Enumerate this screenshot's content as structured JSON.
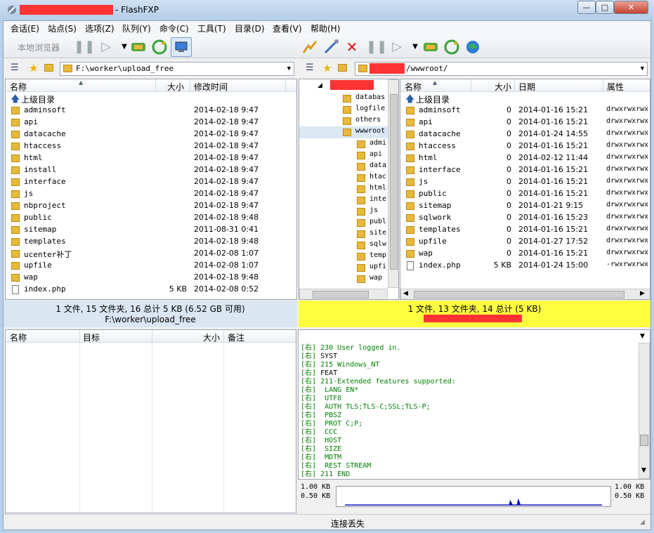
{
  "window": {
    "title": "- FlashFXP"
  },
  "menu": [
    "会话(E)",
    "站点(S)",
    "选项(Z)",
    "队列(Y)",
    "命令(C)",
    "工具(T)",
    "目录(D)",
    "查看(V)",
    "帮助(H)"
  ],
  "left_toolbar": {
    "local_label": "本地浏览器"
  },
  "left_path": "F:\\worker\\upload_free",
  "right_path": "/wwwroot/",
  "left_headers": {
    "name": "名称",
    "size": "大小",
    "modified": "修改时间"
  },
  "right_headers": {
    "name": "名称",
    "size": "大小",
    "date": "日期",
    "attr": "属性"
  },
  "parent_dir": "上级目录",
  "left_files": [
    {
      "name": "adminsoft",
      "size": "",
      "date": "2014-02-18 9:47"
    },
    {
      "name": "api",
      "size": "",
      "date": "2014-02-18 9:47"
    },
    {
      "name": "datacache",
      "size": "",
      "date": "2014-02-18 9:47"
    },
    {
      "name": "htaccess",
      "size": "",
      "date": "2014-02-18 9:47"
    },
    {
      "name": "html",
      "size": "",
      "date": "2014-02-18 9:47"
    },
    {
      "name": "install",
      "size": "",
      "date": "2014-02-18 9:47"
    },
    {
      "name": "interface",
      "size": "",
      "date": "2014-02-18 9:47"
    },
    {
      "name": "js",
      "size": "",
      "date": "2014-02-18 9:47"
    },
    {
      "name": "nbproject",
      "size": "",
      "date": "2014-02-18 9:47"
    },
    {
      "name": "public",
      "size": "",
      "date": "2014-02-18 9:48"
    },
    {
      "name": "sitemap",
      "size": "",
      "date": "2011-08-31 0:41"
    },
    {
      "name": "templates",
      "size": "",
      "date": "2014-02-18 9:48"
    },
    {
      "name": "ucenter补丁",
      "size": "",
      "date": "2014-02-08 1:07"
    },
    {
      "name": "upfile",
      "size": "",
      "date": "2014-02-08 1:07"
    },
    {
      "name": "wap",
      "size": "",
      "date": "2014-02-18 9:48"
    },
    {
      "name": "index.php",
      "size": "5 KB",
      "date": "2014-02-08 0:52",
      "file": true
    }
  ],
  "right_files": [
    {
      "name": "adminsoft",
      "size": "0",
      "date": "2014-01-16 15:21",
      "attr": "drwxrwxrwx"
    },
    {
      "name": "api",
      "size": "0",
      "date": "2014-01-16 15:21",
      "attr": "drwxrwxrwx"
    },
    {
      "name": "datacache",
      "size": "0",
      "date": "2014-01-24 14:55",
      "attr": "drwxrwxrwx"
    },
    {
      "name": "htaccess",
      "size": "0",
      "date": "2014-01-16 15:21",
      "attr": "drwxrwxrwx"
    },
    {
      "name": "html",
      "size": "0",
      "date": "2014-02-12 11:44",
      "attr": "drwxrwxrwx"
    },
    {
      "name": "interface",
      "size": "0",
      "date": "2014-01-16 15:21",
      "attr": "drwxrwxrwx"
    },
    {
      "name": "js",
      "size": "0",
      "date": "2014-01-16 15:21",
      "attr": "drwxrwxrwx"
    },
    {
      "name": "public",
      "size": "0",
      "date": "2014-01-16 15:21",
      "attr": "drwxrwxrwx"
    },
    {
      "name": "sitemap",
      "size": "0",
      "date": "2014-01-21 9:15",
      "attr": "drwxrwxrwx"
    },
    {
      "name": "sqlwork",
      "size": "0",
      "date": "2014-01-16 15:23",
      "attr": "drwxrwxrwx"
    },
    {
      "name": "templates",
      "size": "0",
      "date": "2014-01-16 15:21",
      "attr": "drwxrwxrwx"
    },
    {
      "name": "upfile",
      "size": "0",
      "date": "2014-01-27 17:52",
      "attr": "drwxrwxrwx"
    },
    {
      "name": "wap",
      "size": "0",
      "date": "2014-01-16 15:21",
      "attr": "drwxrwxrwx"
    },
    {
      "name": "index.php",
      "size": "5 KB",
      "date": "2014-01-24 15:00",
      "attr": "-rwxrwxrwx",
      "file": true
    }
  ],
  "tree_top": [
    "databas",
    "logfile",
    "others",
    "wwwroot"
  ],
  "tree_children": [
    "admi",
    "api",
    "data",
    "htac",
    "html",
    "inte",
    "js",
    "publ",
    "site",
    "sqlw",
    "temp",
    "upfi",
    "wap"
  ],
  "left_status": {
    "line1": "1 文件, 15 文件夹, 16 总计 5 KB (6.52 GB 可用)",
    "line2": "F:\\worker\\upload_free"
  },
  "right_status": {
    "line1": "1 文件, 13 文件夹, 14 总计 (5 KB)"
  },
  "queue_headers": {
    "name": "名称",
    "target": "目标",
    "size": "大小",
    "note": "备注"
  },
  "log_lines": [
    {
      "p": "[右]",
      "t": "230 User logged in.",
      "c": "#008000"
    },
    {
      "p": "[右]",
      "t": "SYST",
      "c": "#000000"
    },
    {
      "p": "[右]",
      "t": "215 Windows_NT",
      "c": "#008000"
    },
    {
      "p": "[右]",
      "t": "FEAT",
      "c": "#000000"
    },
    {
      "p": "[右]",
      "t": "211-Extended features supported:",
      "c": "#008000"
    },
    {
      "p": "[右]",
      "t": " LANG EN*",
      "c": "#008000"
    },
    {
      "p": "[右]",
      "t": " UTF8",
      "c": "#008000"
    },
    {
      "p": "[右]",
      "t": " AUTH TLS;TLS-C;SSL;TLS-P;",
      "c": "#008000"
    },
    {
      "p": "[右]",
      "t": " PBSZ",
      "c": "#008000"
    },
    {
      "p": "[右]",
      "t": " PROT C;P;",
      "c": "#008000"
    },
    {
      "p": "[右]",
      "t": " CCC",
      "c": "#008000"
    },
    {
      "p": "[右]",
      "t": " HOST",
      "c": "#008000"
    },
    {
      "p": "[右]",
      "t": " SIZE",
      "c": "#008000"
    },
    {
      "p": "[右]",
      "t": " MDTM",
      "c": "#008000"
    },
    {
      "p": "[右]",
      "t": " REST STREAM",
      "c": "#008000"
    },
    {
      "p": "[右]",
      "t": "211 END",
      "c": "#008000"
    }
  ],
  "graph": {
    "top_label": "1.00 KB",
    "mid_label": "0.50 KB"
  },
  "statusbar": "连接丢失",
  "colors": {
    "highlight": "#fffd40",
    "redaction": "#ff3333",
    "log_prefix": "#008000"
  }
}
